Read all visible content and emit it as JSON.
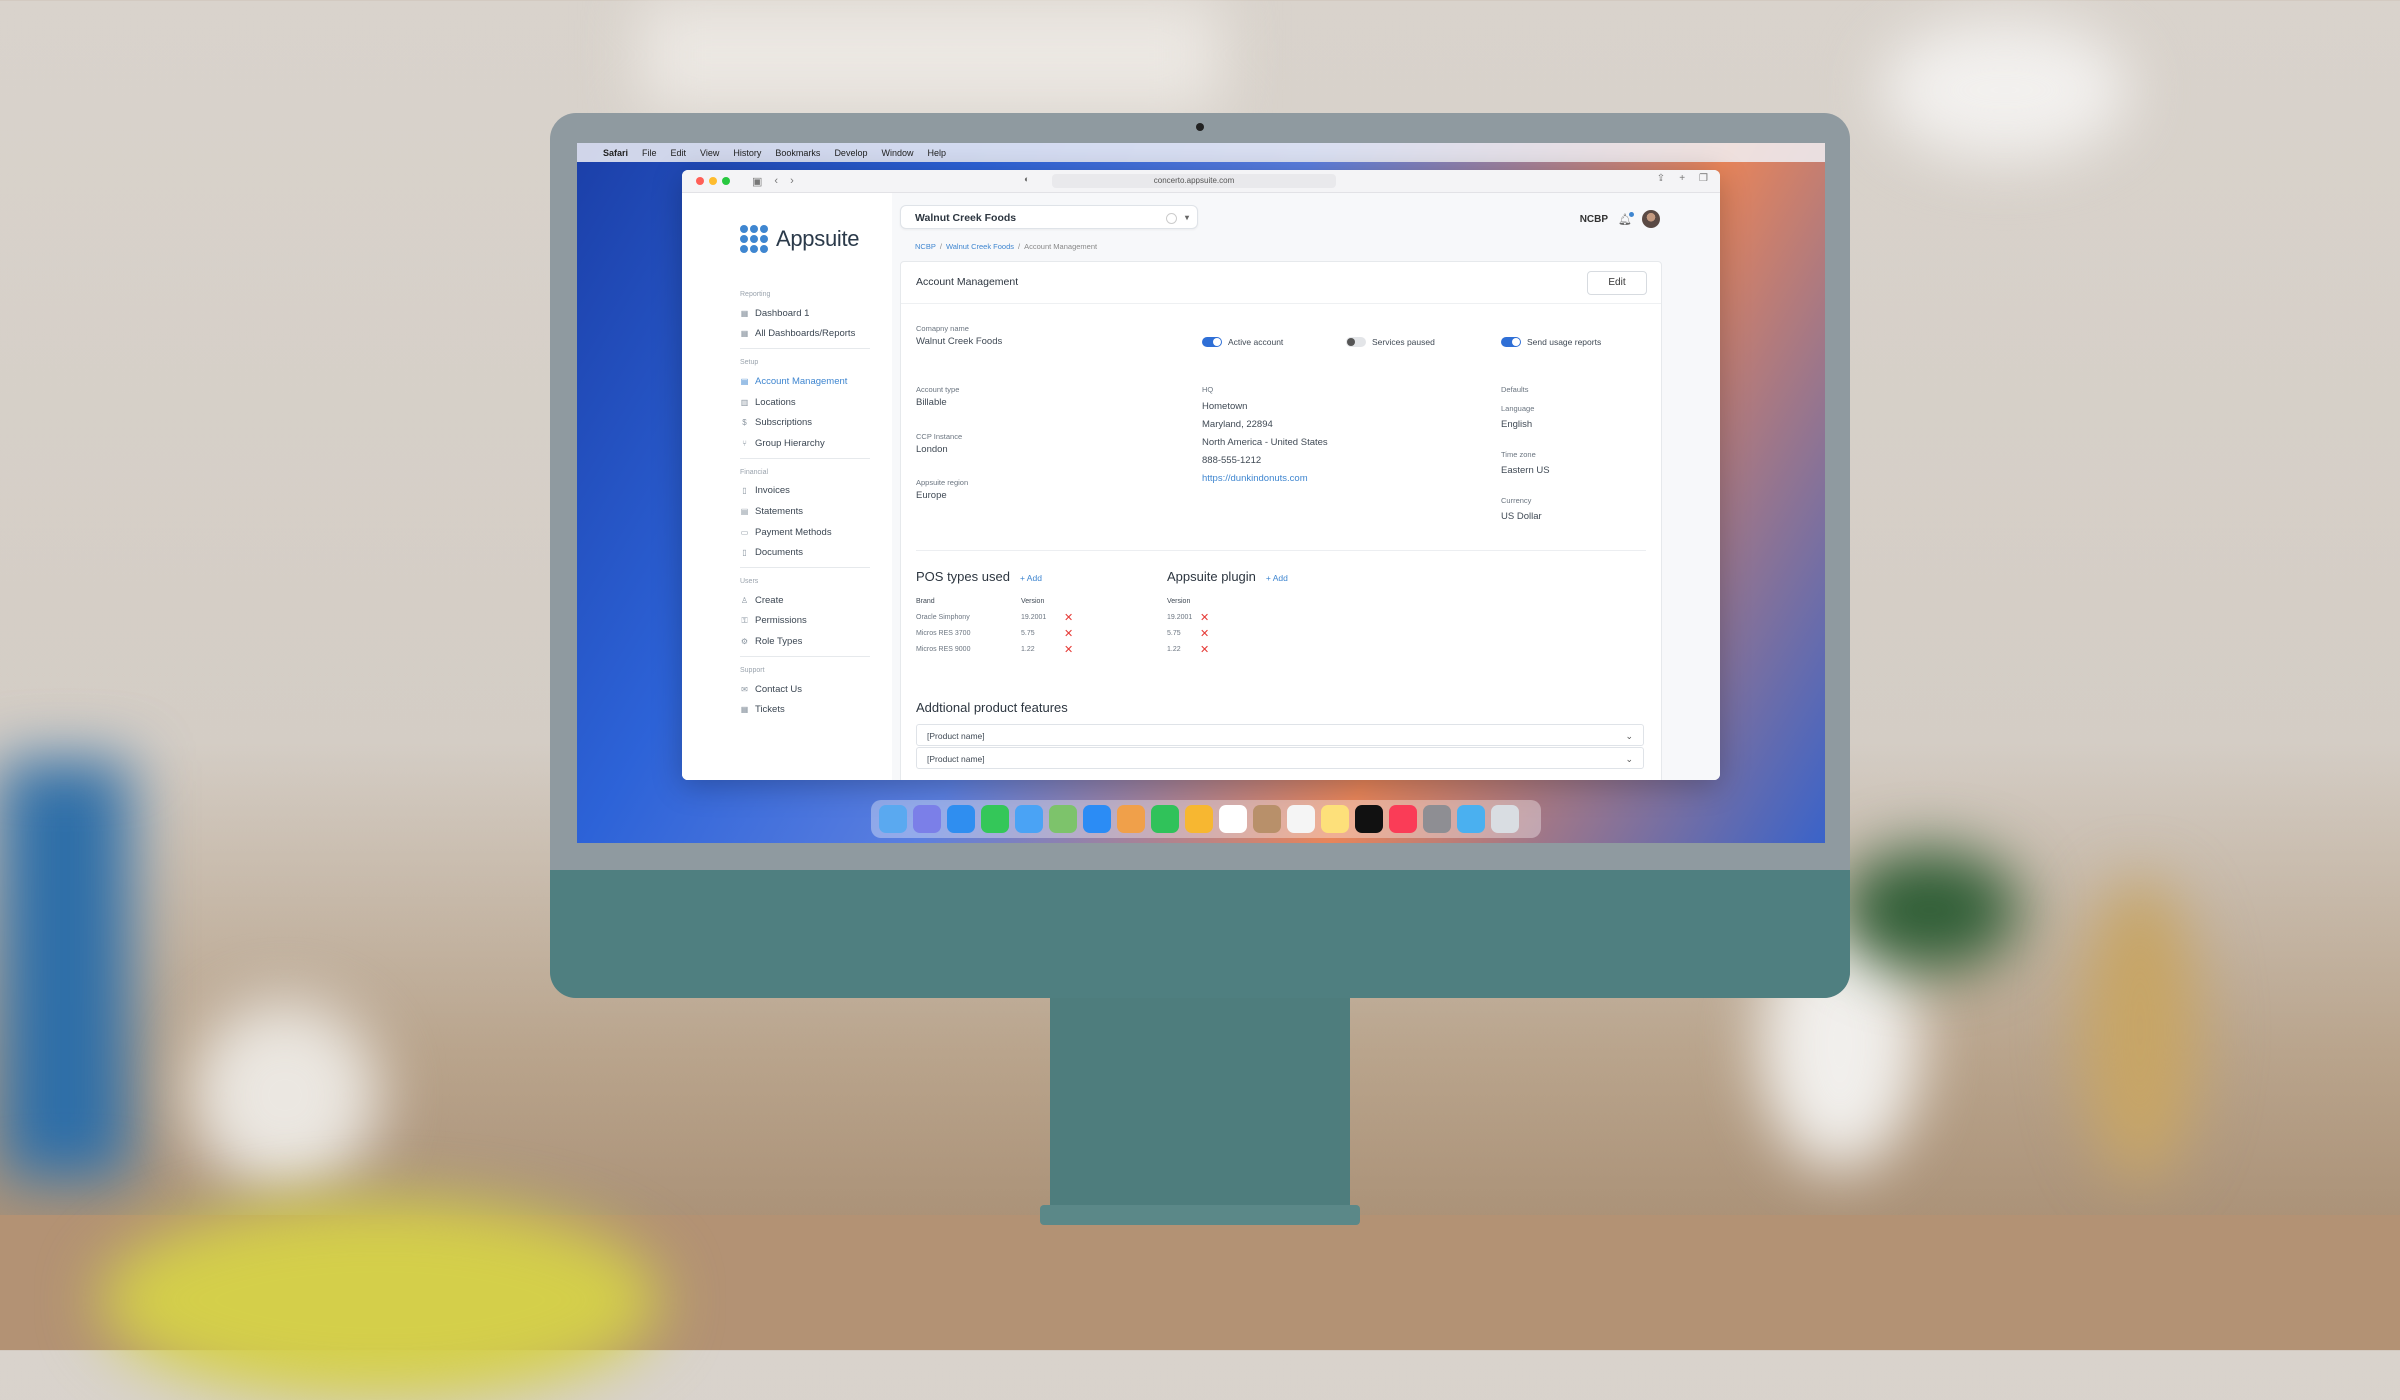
{
  "menubar": {
    "app": "Safari",
    "items": [
      "File",
      "Edit",
      "View",
      "History",
      "Bookmarks",
      "Develop",
      "Window",
      "Help"
    ]
  },
  "browser": {
    "url": "concerto.appsuite.com"
  },
  "brand": {
    "name": "Appsuite",
    "accent": "#3f86d0"
  },
  "header": {
    "company": "Walnut Creek Foods",
    "org": "NCBP",
    "breadcrumb": [
      "NCBP",
      "Walnut Creek Foods",
      "Account Management"
    ]
  },
  "sidebar": {
    "sections": [
      {
        "title": "Reporting",
        "items": [
          {
            "label": "Dashboard 1",
            "icon": "grid-icon"
          },
          {
            "label": "All Dashboards/Reports",
            "icon": "grid-icon"
          }
        ]
      },
      {
        "title": "Setup",
        "items": [
          {
            "label": "Account Management",
            "icon": "account-icon",
            "active": true
          },
          {
            "label": "Locations",
            "icon": "location-icon"
          },
          {
            "label": "Subscriptions",
            "icon": "subscription-icon"
          },
          {
            "label": "Group Hierarchy",
            "icon": "hierarchy-icon"
          }
        ]
      },
      {
        "title": "Financial",
        "items": [
          {
            "label": "Invoices",
            "icon": "invoice-icon"
          },
          {
            "label": "Statements",
            "icon": "statement-icon"
          },
          {
            "label": "Payment Methods",
            "icon": "card-icon"
          },
          {
            "label": "Documents",
            "icon": "document-icon"
          }
        ]
      },
      {
        "title": "Users",
        "items": [
          {
            "label": "Create",
            "icon": "user-add-icon"
          },
          {
            "label": "Permissions",
            "icon": "permission-icon"
          },
          {
            "label": "Role Types",
            "icon": "role-icon"
          }
        ]
      },
      {
        "title": "Support",
        "items": [
          {
            "label": "Contact Us",
            "icon": "mail-icon"
          },
          {
            "label": "Tickets",
            "icon": "ticket-icon"
          }
        ]
      }
    ]
  },
  "card": {
    "title": "Account Management",
    "edit_label": "Edit",
    "company_name_label": "Comapny name",
    "company_name": "Walnut Creek Foods",
    "toggles": [
      {
        "label": "Active account",
        "on": true
      },
      {
        "label": "Services paused",
        "on": false
      },
      {
        "label": "Send usage reports",
        "on": true
      }
    ],
    "account_type_label": "Account type",
    "account_type": "Billable",
    "ccp_label": "CCP Instance",
    "ccp": "London",
    "region_label": "Appsuite region",
    "region": "Europe",
    "hq_label": "HQ",
    "hq": {
      "line1": "Hometown",
      "line2": "Maryland, 22894",
      "line3": "North America - United States",
      "phone": "888-555-1212",
      "url": "https://dunkindonuts.com"
    },
    "defaults_label": "Defaults",
    "language_label": "Language",
    "language": "English",
    "timezone_label": "Time zone",
    "timezone": "Eastern US",
    "currency_label": "Currency",
    "currency": "US Dollar"
  },
  "pos": {
    "title": "POS types used",
    "add_label": "+ Add",
    "headers": [
      "Brand",
      "Version"
    ],
    "rows": [
      {
        "brand": "Oracle Simphony",
        "version": "19.2001"
      },
      {
        "brand": "Micros RES 3700",
        "version": "5.75"
      },
      {
        "brand": "Micros RES 9000",
        "version": "1.22"
      }
    ]
  },
  "plugin": {
    "title": "Appsuite plugin",
    "add_label": "+ Add",
    "header": "Version",
    "rows": [
      "19.2001",
      "5.75",
      "1.22"
    ]
  },
  "features": {
    "title": "Addtional product features",
    "selects": [
      "[Product name]",
      "[Product name]"
    ]
  }
}
